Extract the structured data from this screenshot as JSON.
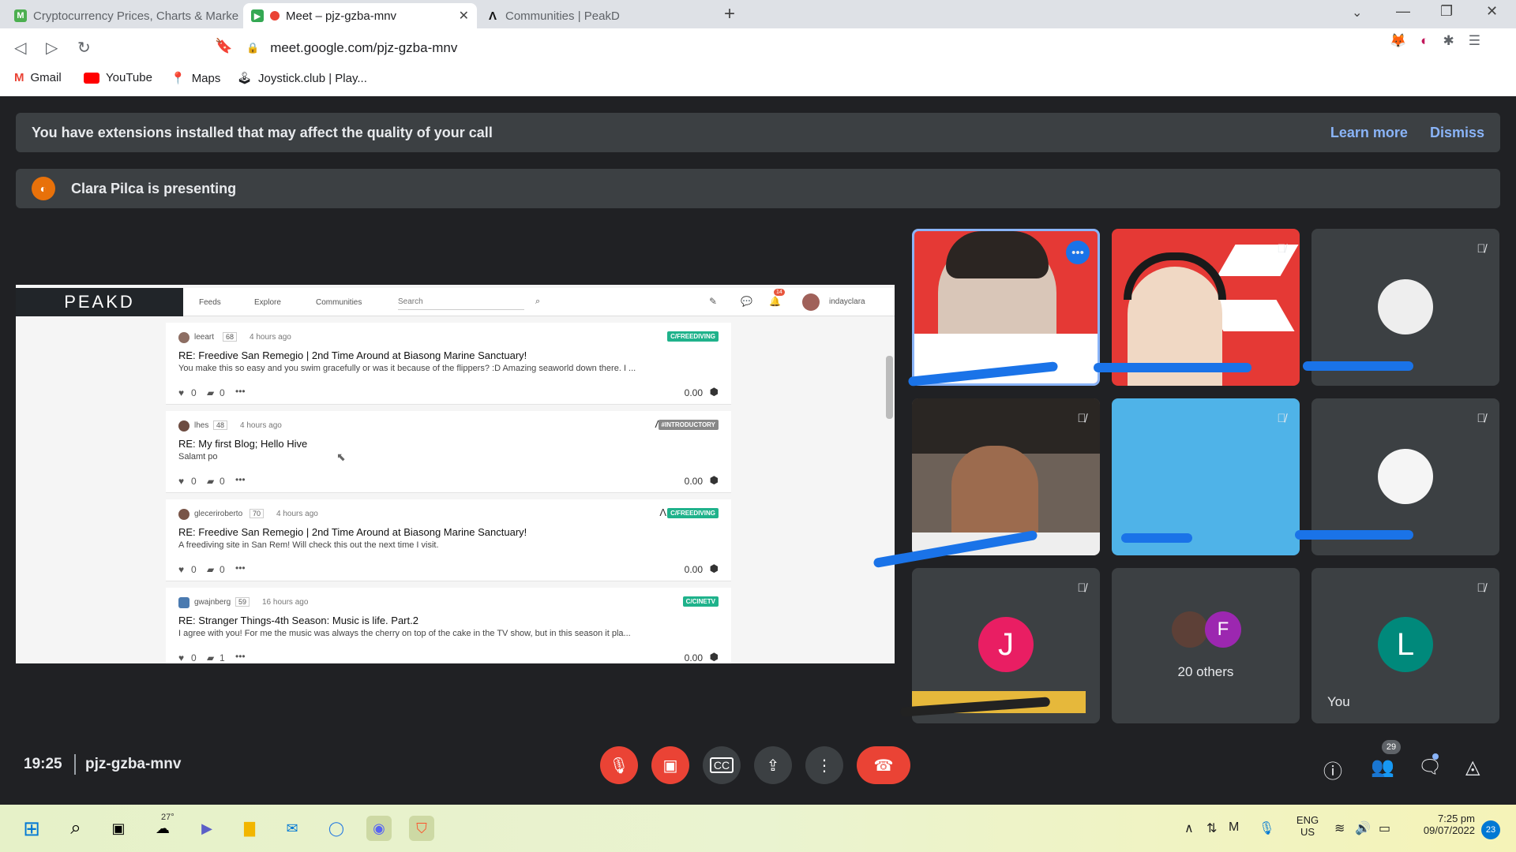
{
  "browser": {
    "tabs": [
      {
        "title": "Cryptocurrency Prices, Charts & Marke",
        "active": false
      },
      {
        "title": "Meet – pjz-gzba-mnv",
        "active": true
      },
      {
        "title": "Communities | PeakD",
        "active": false
      }
    ],
    "new_tab_glyph": "+",
    "url": "meet.google.com/pjz-gzba-mnv",
    "bookmarks": [
      "Gmail",
      "YouTube",
      "Maps",
      "Joystick.club | Play..."
    ]
  },
  "meet": {
    "extension_banner": {
      "text": "You have extensions installed that may affect the quality of your call",
      "learn_more": "Learn more",
      "dismiss": "Dismiss"
    },
    "presenting_banner": "Clara Pilca is presenting",
    "tiles": [
      {
        "initial": "J",
        "color": "#e91e63"
      },
      {
        "label": "20 others",
        "initial": "F",
        "color": "#9c27b0"
      },
      {
        "initial": "L",
        "label": "You",
        "color": "#00897b"
      }
    ],
    "time": "19:25",
    "meeting_code": "pjz-gzba-mnv",
    "participants_count": "29"
  },
  "peakd": {
    "logo": "PEAKD",
    "nav": [
      "Feeds",
      "Explore",
      "Communities"
    ],
    "search_placeholder": "Search",
    "notifications": "14",
    "user": "indayclara",
    "posts": [
      {
        "author": "leeart",
        "rep": "68",
        "time": "4 hours ago",
        "tag": "C/FREEDIVING",
        "title": "RE: Freedive San Remegio | 2nd Time Around at Biasong Marine Sanctuary!",
        "body": "You make this so easy and you swim gracefully or was it because of the flippers? :D Amazing seaworld down there. I ...",
        "likes": "0",
        "comments": "0",
        "payout": "0.00"
      },
      {
        "author": "lhes",
        "rep": "48",
        "time": "4 hours ago",
        "tag": "#INTRODUCTORY",
        "title": "RE: My first Blog; Hello Hive",
        "body": "Salamt po",
        "likes": "0",
        "comments": "0",
        "payout": "0.00"
      },
      {
        "author": "gleceriroberto",
        "rep": "70",
        "time": "4 hours ago",
        "tag": "C/FREEDIVING",
        "title": "RE: Freedive San Remegio | 2nd Time Around at Biasong Marine Sanctuary!",
        "body": "A freediving site in San Rem! Will check this out the next time I visit.",
        "likes": "0",
        "comments": "0",
        "payout": "0.00"
      },
      {
        "author": "gwajnberg",
        "rep": "59",
        "time": "16 hours ago",
        "tag": "C/CINETV",
        "title": "RE: Stranger Things-4th Season: Music is life. Part.2",
        "body": "I agree with you! For me the music was always the cherry on top of the cake in the TV show, but in this season it pla...",
        "likes": "0",
        "comments": "1",
        "payout": "0.00"
      }
    ]
  },
  "taskbar": {
    "weather": "27°",
    "language": "ENG",
    "region": "US",
    "clock_time": "7:25 pm",
    "clock_date": "09/07/2022",
    "notification_count": "23"
  }
}
